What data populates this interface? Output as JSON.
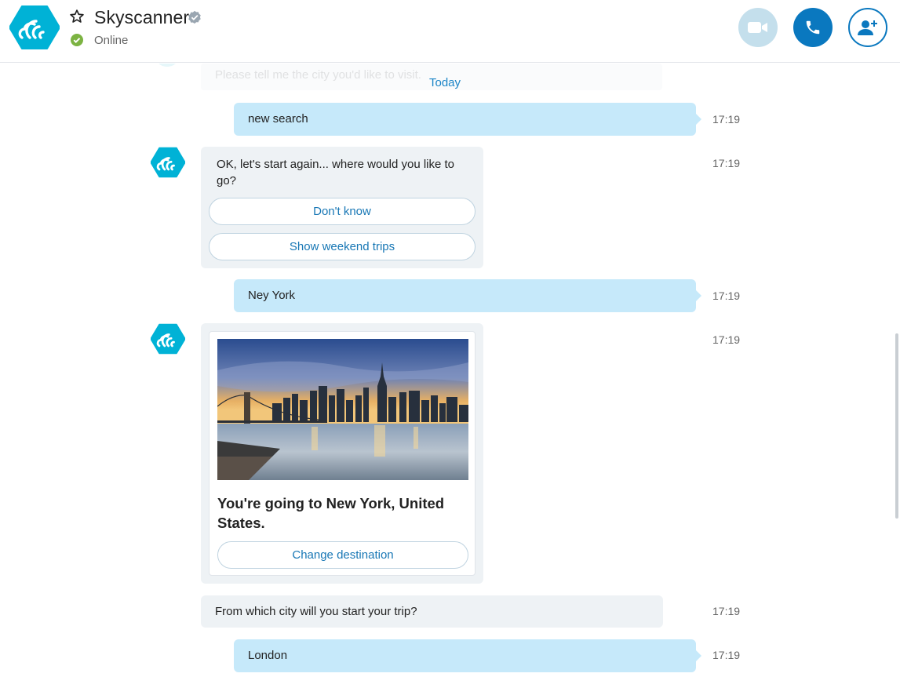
{
  "header": {
    "title": "Skyscanner",
    "status": "Online",
    "colors": {
      "accent": "#0a78bf",
      "online": "#7cb342",
      "avatar": "#00b2d6"
    }
  },
  "chat": {
    "faded_message": "Please tell me the city you'd like to visit.",
    "day_separator": "Today",
    "messages": [
      {
        "type": "outgoing",
        "text": "new search",
        "time": "17:19"
      },
      {
        "type": "incoming",
        "text": "OK, let's start again... where would you like to go?",
        "time": "17:19",
        "buttons": [
          "Don't know",
          "Show weekend trips"
        ]
      },
      {
        "type": "outgoing",
        "text": "Ney York",
        "time": "17:19"
      },
      {
        "type": "incoming-card",
        "time": "17:19",
        "card_title": "You're going to New York, United States.",
        "card_button": "Change destination"
      },
      {
        "type": "incoming",
        "text": "From which city will you start your trip?",
        "time": "17:19"
      },
      {
        "type": "outgoing",
        "text": "London",
        "time": "17:19"
      }
    ]
  }
}
